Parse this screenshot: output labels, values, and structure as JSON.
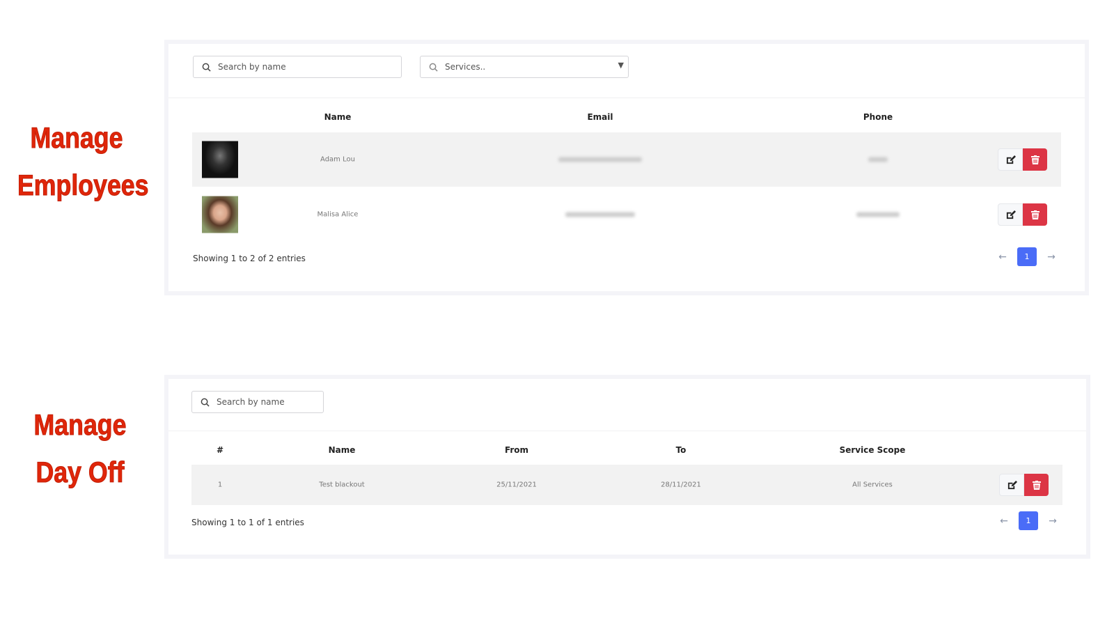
{
  "labels": {
    "employees": [
      "Manage",
      "Employees"
    ],
    "dayoff": [
      "Manage",
      "Day Off"
    ]
  },
  "employees": {
    "search_placeholder": "Search by name",
    "services_placeholder": "Services..",
    "columns": [
      "Name",
      "Email",
      "Phone"
    ],
    "rows": [
      {
        "name": "Adam Lou"
      },
      {
        "name": "Malisa Alice"
      }
    ],
    "info": "Showing 1 to 2 of 2 entries",
    "page": "1"
  },
  "dayoff": {
    "search_placeholder": "Search by name",
    "columns": [
      "#",
      "Name",
      "From",
      "To",
      "Service Scope"
    ],
    "rows": [
      {
        "num": "1",
        "name": "Test blackout",
        "from": "25/11/2021",
        "to": "28/11/2021",
        "scope": "All Services"
      }
    ],
    "info": "Showing 1 to 1 of 1 entries",
    "page": "1"
  },
  "colors": {
    "label": "#e0260a",
    "delete": "#dc3545",
    "page_active": "#4a6cf7"
  }
}
